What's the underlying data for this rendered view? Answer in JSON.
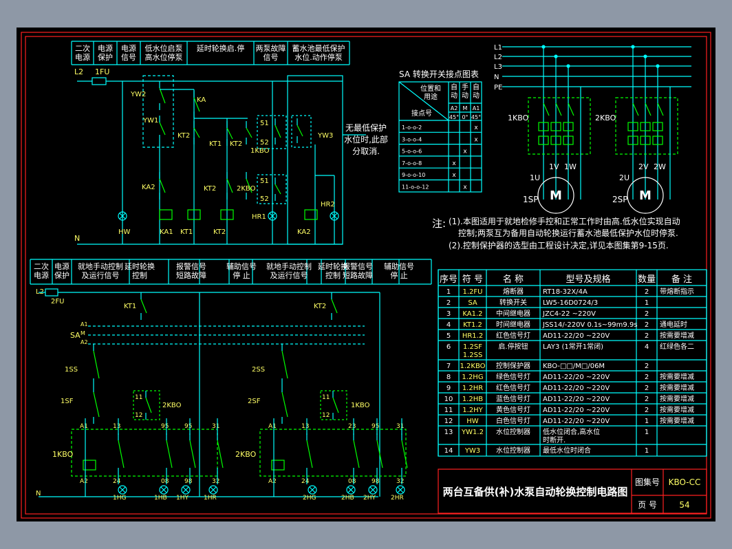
{
  "upper_header": [
    "二次\n电源",
    "电源\n保护",
    "电源\n信号",
    "低水位启泵\n高水位停泵",
    "延时轮换启.停",
    "两泵故障\n信号",
    "蓄水池最低保护\n水位.动作停泵"
  ],
  "lower_header": [
    "二次\n电源",
    "电源\n保护",
    "就地手动控制\n及运行信号",
    "延时轮换\n控制",
    "报警信号\n短路故障",
    "辅助信号\n停  止",
    "就地手动控制\n及运行信号",
    "延时轮换\n控制",
    "报警信号\n短路故障",
    "辅助信号\n停  止"
  ],
  "upper_labels": {
    "l2": "L2",
    "fu": "1FU",
    "n": "N",
    "yw2": "YW2",
    "yw1": "YW1",
    "ka": "KA",
    "kt2a": "KT2",
    "kt1": "KT1",
    "kt2b": "KT2",
    "kbo1": "1KBO",
    "ka2": "KA2",
    "kt2c": "KT2",
    "kbo2": "2KBO",
    "s51a": "51",
    "s52a": "52",
    "s51b": "51",
    "s52b": "52",
    "yw3": "YW3",
    "hr2": "HR2",
    "hw": "HW",
    "ka1": "KA1",
    "kt1c": "KT1",
    "kt2d": "KT2",
    "hr1": "HR1",
    "ka2b": "KA2"
  },
  "yw3_note": [
    "无最低保护",
    "水位时,此部",
    "分取消."
  ],
  "sa_table": {
    "title": "SA 转换开关接点图表",
    "pos_header": "位置和\n用途",
    "contact_header": "接点号",
    "modes": [
      "自\n动",
      "手\n动",
      "自\n动"
    ],
    "mode_codes": [
      "A2",
      "M",
      "A1"
    ],
    "angles": [
      "45°",
      "0°",
      "45°"
    ],
    "rows": [
      {
        "contacts": "1-o-o-2",
        "marks": [
          "",
          "",
          "x"
        ]
      },
      {
        "contacts": "3-o-o-4",
        "marks": [
          "",
          "",
          "x"
        ]
      },
      {
        "contacts": "5-o-o-6",
        "marks": [
          "",
          "x",
          ""
        ]
      },
      {
        "contacts": "7-o-o-8",
        "marks": [
          "x",
          "",
          ""
        ]
      },
      {
        "contacts": "9-o-o-10",
        "marks": [
          "x",
          "",
          ""
        ]
      },
      {
        "contacts": "11-o-o-12",
        "marks": [
          "",
          "x",
          ""
        ]
      }
    ]
  },
  "power": {
    "bus": [
      "L1",
      "L2",
      "L3",
      "N",
      "PE"
    ],
    "motors": [
      {
        "kbo": "1KBO",
        "u": "1U",
        "v": "1V",
        "w": "1W",
        "sp": "1SP",
        "m": "M"
      },
      {
        "kbo": "2KBO",
        "u": "2U",
        "v": "2V",
        "w": "2W",
        "sp": "2SP",
        "m": "M"
      }
    ]
  },
  "notes": {
    "prefix": "注:",
    "lines": [
      "(1).本图适用于就地检修手控和正常工作时由高.低水位实现自动",
      "控制;两泵互为备用自动轮换运行蓄水池最低保护水位时停泵.",
      "(2).控制保护器的选型由工程设计决定,详见本图集第9-15页."
    ]
  },
  "lower_labels": {
    "l2": "L2",
    "fu": "2FU",
    "n": "N",
    "sa": "SA",
    "a1": "A1",
    "m": "M",
    "a2": "A2",
    "kt1": "KT1",
    "kt2": "KT2",
    "ss1": "1SS",
    "ss2": "2SS",
    "sf1": "1SF",
    "sf2": "2SF",
    "kbo2a": "2KBO",
    "kbo1a": "1KBO",
    "kbo1": "1KBO",
    "kbo2": "2KBO",
    "n11a": "11",
    "n12a": "12",
    "n11b": "11",
    "n12b": "12",
    "w1": [
      "A1",
      "13",
      "95",
      "95",
      "31"
    ],
    "w2": [
      "A1",
      "13",
      "23",
      "95",
      "31"
    ],
    "b1": [
      "A2",
      "24",
      "08",
      "98",
      "32"
    ],
    "b2": [
      "A2",
      "24",
      "08",
      "98",
      "32"
    ],
    "lamps1": [
      "1HG",
      "1HB",
      "1HY",
      "1HR"
    ],
    "lamps2": [
      "2HG",
      "2HB",
      "2HY",
      "2HR"
    ]
  },
  "parts_table": {
    "headers": [
      "序号",
      "符 号",
      "名  称",
      "型号及规格",
      "数量",
      "备  注"
    ],
    "rows": [
      [
        "1",
        "1.2FU",
        "熔断器",
        "RT18-32X/4A",
        "2",
        "带熔断指示"
      ],
      [
        "2",
        "SA",
        "转换开关",
        "LW5-16D0724/3",
        "1",
        ""
      ],
      [
        "3",
        "KA1.2",
        "中间继电器",
        "JZC4-22 ~220V",
        "2",
        ""
      ],
      [
        "4",
        "KT1.2",
        "时间继电器",
        "JSS14/-220V 0.1s~99m9.9s",
        "2",
        "通电延时"
      ],
      [
        "5",
        "HR1.2",
        "红色信号灯",
        "AD11-22/20 ~220V",
        "2",
        "按需要增减"
      ],
      [
        "6",
        "1.2SF\n1.2SS",
        "启.停按钮",
        "LAY3 (1常开1常闭)",
        "4",
        "红绿色各二"
      ],
      [
        "7",
        "1.2KBO",
        "控制保护器",
        "KBO-□□/M□/06M",
        "2",
        ""
      ],
      [
        "8",
        "1.2HG",
        "绿色信号灯",
        "AD11-22/20 ~220V",
        "2",
        "按需要增减"
      ],
      [
        "9",
        "1.2HR",
        "红色信号灯",
        "AD11-22/20 ~220V",
        "2",
        "按需要增减"
      ],
      [
        "10",
        "1.2HB",
        "蓝色信号灯",
        "AD11-22/20 ~220V",
        "2",
        "按需要增减"
      ],
      [
        "11",
        "1.2HY",
        "黄色信号灯",
        "AD11-22/20 ~220V",
        "2",
        "按需要增减"
      ],
      [
        "12",
        "HW",
        "白色信号灯",
        "AD11-22/20 ~220V",
        "1",
        "按需要增减"
      ],
      [
        "13",
        "YW1.2",
        "水位控制器",
        "低水位闭合,高水位\n时断开.",
        "1",
        ""
      ],
      [
        "14",
        "YW3",
        "水位控制器",
        "最低水位时闭合",
        "1",
        ""
      ]
    ]
  },
  "title_block": {
    "title": "两台互备供(补)水泵自动轮换控制电路图",
    "atlas_label": "图集号",
    "atlas_value": "KBO-CC",
    "page_label": "页 号",
    "page_value": "54"
  },
  "colors": {
    "frame": "#ff2020",
    "wire": "#00ffff",
    "comp": "#00ff00",
    "label": "#ffff66",
    "text": "#ffffff",
    "dashed": "#00ffff"
  }
}
